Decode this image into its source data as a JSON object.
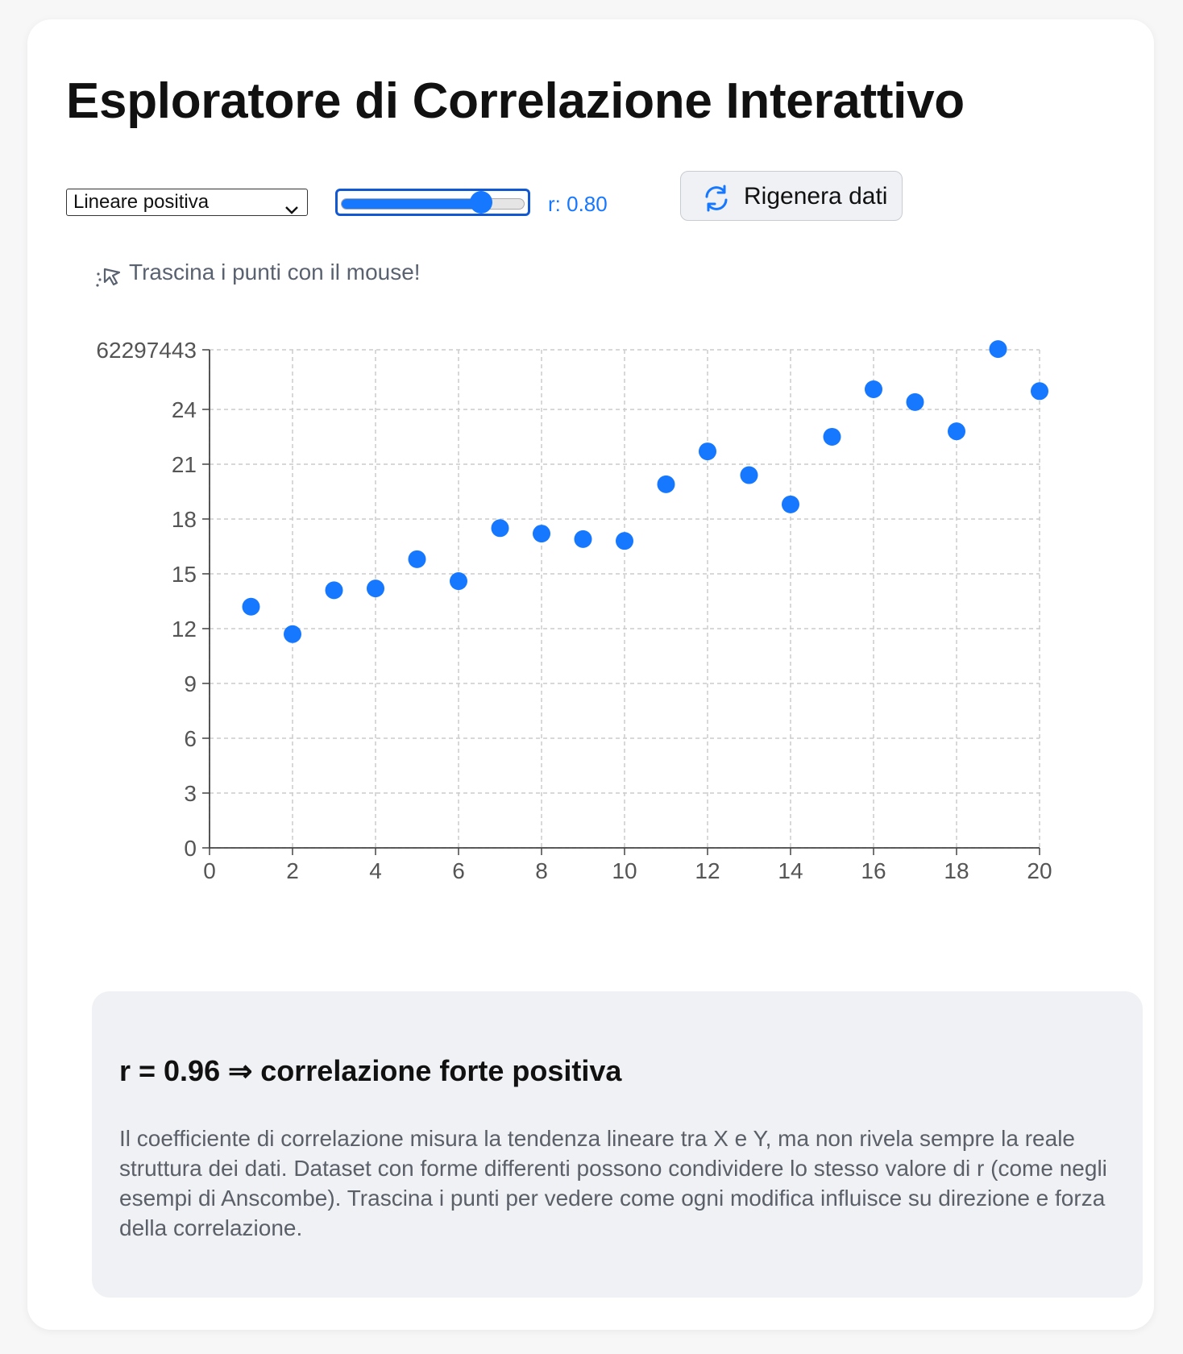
{
  "title": "Esploratore di Correlazione Interattivo",
  "controls": {
    "dataset_select": "Lineare positiva",
    "slider_value": 0.8,
    "r_label": "r: 0.80",
    "regen_label": "Rigenera dati"
  },
  "hint": "Trascina i punti con il mouse!",
  "colors": {
    "accent": "#1677ff",
    "grid": "#cccccc",
    "panel": "#f0f1f4"
  },
  "icons": {
    "hint": "cursor-drag-icon",
    "regen": "refresh-icon",
    "select": "chevron-down-icon"
  },
  "chart_data": {
    "type": "scatter",
    "title": "",
    "xlabel": "",
    "ylabel": "",
    "xlim": [
      0,
      20
    ],
    "ylim": [
      0,
      27.262297443
    ],
    "x_ticks": [
      0,
      2,
      4,
      6,
      8,
      10,
      12,
      14,
      16,
      18,
      20
    ],
    "x_tick_labels": [
      "0",
      "2",
      "4",
      "6",
      "8",
      "10",
      "12",
      "14",
      "16",
      "18",
      "20"
    ],
    "y_ticks": [
      0,
      3,
      6,
      9,
      12,
      15,
      18,
      21,
      24,
      27.262297443
    ],
    "y_tick_labels": [
      "0",
      "3",
      "6",
      "9",
      "12",
      "15",
      "18",
      "21",
      "24",
      "62297443"
    ],
    "grid": true,
    "series": [
      {
        "color": "#1677ff",
        "points": [
          [
            1,
            13.2
          ],
          [
            2,
            11.7
          ],
          [
            3,
            14.1
          ],
          [
            4,
            14.2
          ],
          [
            5,
            15.8
          ],
          [
            6,
            14.6
          ],
          [
            7,
            17.5
          ],
          [
            8,
            17.2
          ],
          [
            9,
            16.9
          ],
          [
            10,
            16.8
          ],
          [
            11,
            19.9
          ],
          [
            12,
            21.7
          ],
          [
            13,
            20.4
          ],
          [
            14,
            18.8
          ],
          [
            15,
            22.5
          ],
          [
            16,
            25.1
          ],
          [
            17,
            24.4
          ],
          [
            18,
            22.8
          ],
          [
            19,
            27.3
          ],
          [
            20,
            25.0
          ]
        ]
      }
    ]
  },
  "info": {
    "heading": "r = 0.96 ⇒ correlazione forte positiva",
    "body": "Il coefficiente di correlazione misura la tendenza lineare tra X e Y, ma non rivela sempre la reale struttura dei dati. Dataset con forme differenti possono condividere lo stesso valore di r (come negli esempi di Anscombe). Trascina i punti per vedere come ogni modifica influisce su direzione e forza della correlazione."
  }
}
